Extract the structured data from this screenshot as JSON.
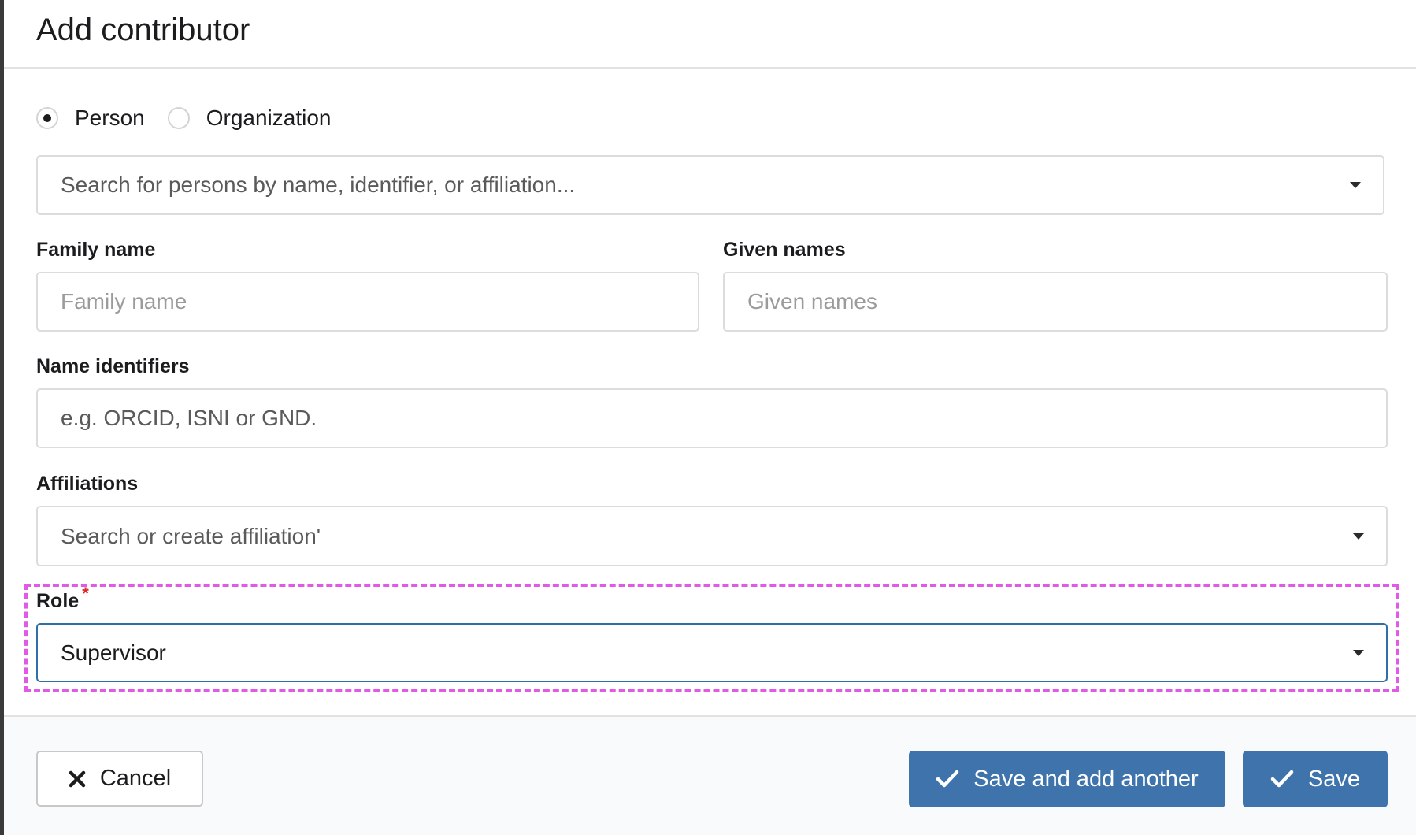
{
  "modal": {
    "title": "Add contributor"
  },
  "type_selector": {
    "options": [
      {
        "label": "Person",
        "checked": true
      },
      {
        "label": "Organization",
        "checked": false
      }
    ]
  },
  "search": {
    "placeholder": "Search for persons by name, identifier, or affiliation..."
  },
  "fields": {
    "family_name": {
      "label": "Family name",
      "placeholder": "Family name"
    },
    "given_names": {
      "label": "Given names",
      "placeholder": "Given names"
    },
    "name_identifiers": {
      "label": "Name identifiers",
      "placeholder": "e.g. ORCID, ISNI or GND."
    },
    "affiliations": {
      "label": "Affiliations",
      "placeholder": "Search or create affiliation'"
    },
    "role": {
      "label": "Role",
      "required_mark": "*",
      "value": "Supervisor"
    }
  },
  "actions": {
    "cancel_label": "Cancel",
    "save_and_add_label": "Save and add another",
    "save_label": "Save"
  },
  "colors": {
    "primary": "#3e73ab",
    "highlight": "#e05ae6",
    "required": "#db2828"
  },
  "icons": {
    "cancel": "close-icon",
    "save": "check-icon"
  }
}
